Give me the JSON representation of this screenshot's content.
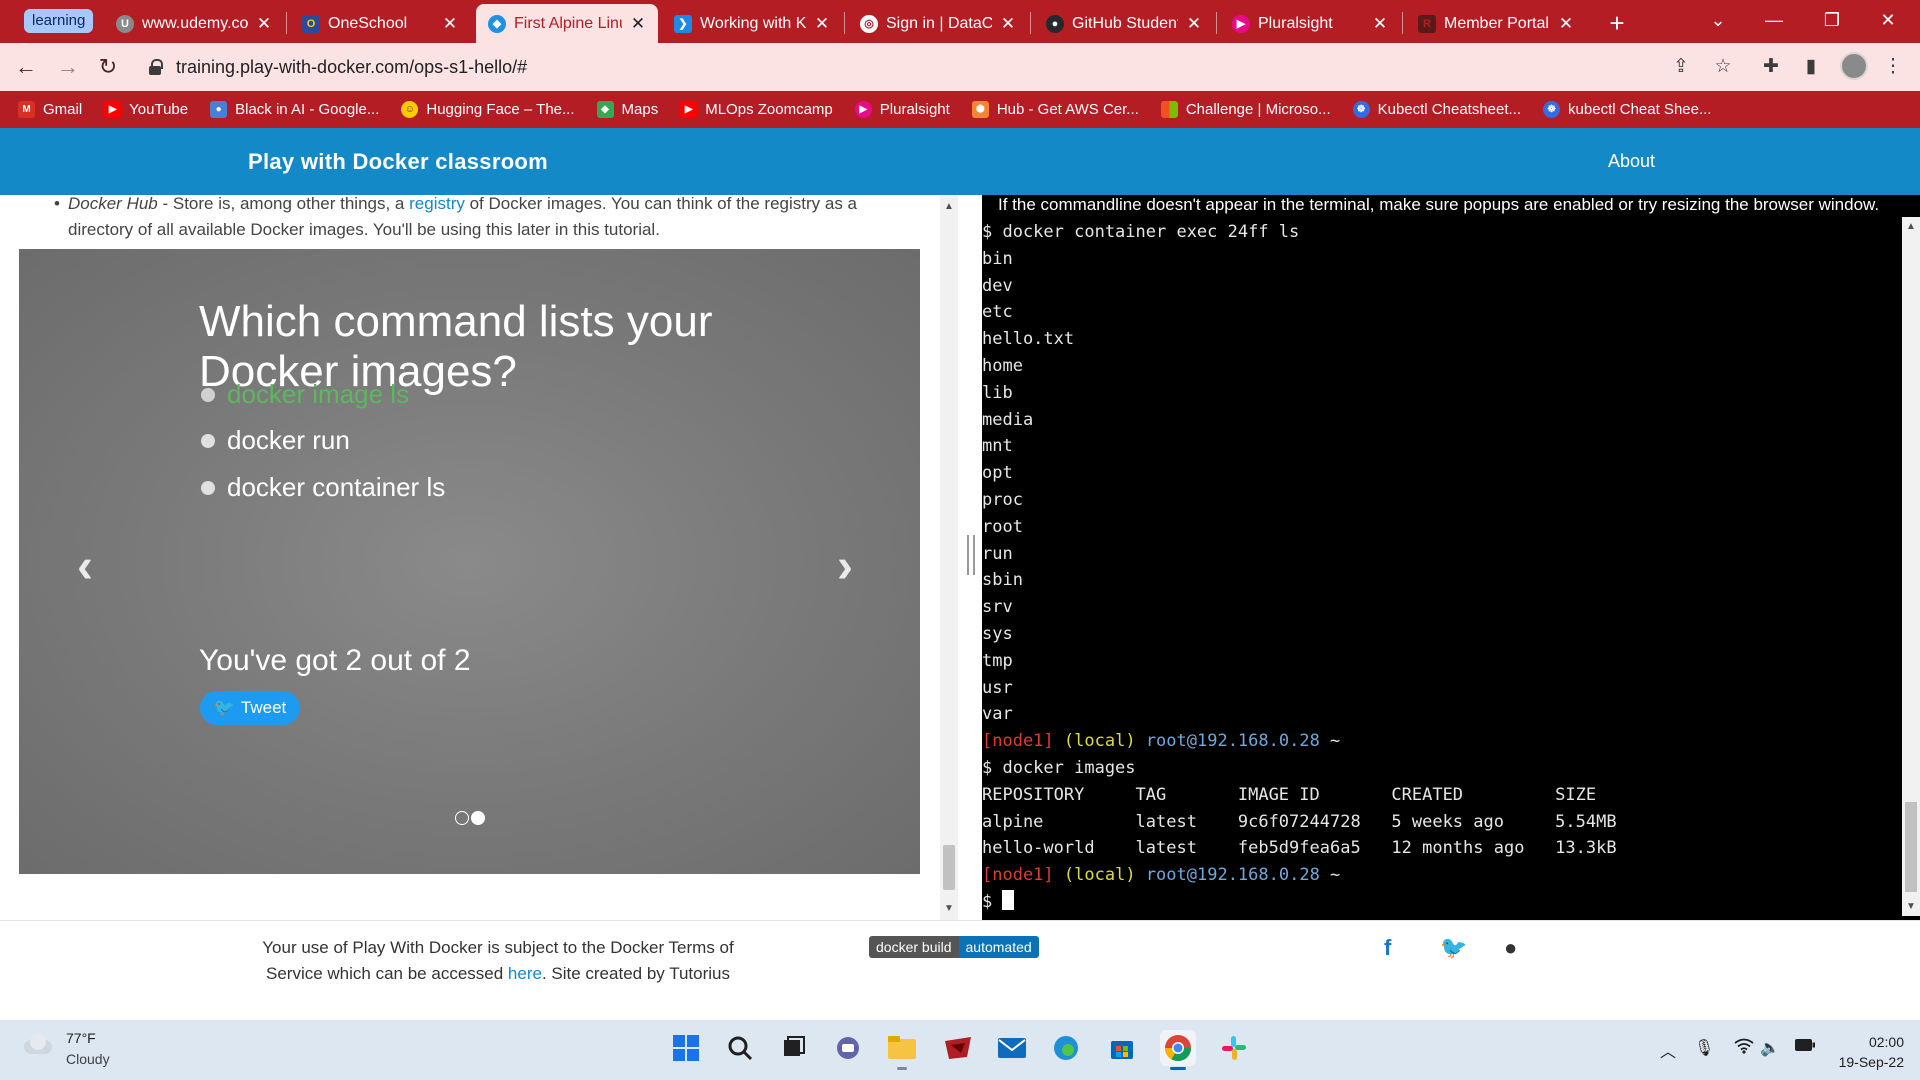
{
  "browser": {
    "tab_group_label": "learning",
    "tabs": [
      {
        "title": "www.udemy.com",
        "icon": "udemy-icon"
      },
      {
        "title": "OneSchool",
        "icon": "oneschool-icon"
      },
      {
        "title": "First Alpine Linux",
        "icon": "docker-icon",
        "active": true
      },
      {
        "title": "Working with Ku",
        "icon": "vscode-icon"
      },
      {
        "title": "Sign in | DataCa",
        "icon": "globe-icon"
      },
      {
        "title": "GitHub Student",
        "icon": "github-icon"
      },
      {
        "title": "Pluralsight",
        "icon": "pluralsight-icon"
      },
      {
        "title": "Member Portal",
        "icon": "member-portal-icon"
      }
    ],
    "url": "training.play-with-docker.com/ops-s1-hello/#",
    "bookmarks": [
      {
        "label": "Gmail",
        "color": "#d93025"
      },
      {
        "label": "YouTube",
        "color": "#ff0000"
      },
      {
        "label": "Black in AI - Google...",
        "color": "#4a7fd8"
      },
      {
        "label": "Hugging Face – The...",
        "color": "#ffcc00"
      },
      {
        "label": "Maps",
        "color": "#34a853"
      },
      {
        "label": "MLOps Zoomcamp",
        "color": "#ff0000"
      },
      {
        "label": "Pluralsight",
        "color": "#e80a89"
      },
      {
        "label": "Hub - Get AWS Cer...",
        "color": "#f58536"
      },
      {
        "label": "Challenge | Microso...",
        "color": "#7fba00"
      },
      {
        "label": "Kubectl Cheatsheet...",
        "color": "#326ce5"
      },
      {
        "label": "kubectl Cheat Shee...",
        "color": "#326ce5"
      }
    ]
  },
  "site": {
    "brand": "Play with Docker classroom",
    "nav_about": "About"
  },
  "content": {
    "intro_term": "Docker Hub",
    "intro_before_link": " - Store is, among other things, a ",
    "intro_link": "registry",
    "intro_after_link": " of Docker images. You can think of the registry as a directory of all available Docker images. You'll be using this later in this tutorial."
  },
  "quiz": {
    "question": "Which command lists your Docker images?",
    "options": [
      {
        "label": "docker image ls",
        "correct": true
      },
      {
        "label": "docker run",
        "correct": false
      },
      {
        "label": "docker container ls",
        "correct": false
      }
    ],
    "score": "You've got 2 out of 2",
    "tweet_label": "Tweet"
  },
  "terminal": {
    "note": "If the commandline doesn't appear in the terminal, make sure popups are enabled or try resizing the browser window.",
    "exec_cmd": "$ docker container exec 24ff ls",
    "ls_output": [
      "bin",
      "dev",
      "etc",
      "hello.txt",
      "home",
      "lib",
      "media",
      "mnt",
      "opt",
      "proc",
      "root",
      "run",
      "sbin",
      "srv",
      "sys",
      "tmp",
      "usr",
      "var"
    ],
    "prompt_node": "[node1]",
    "prompt_local": "(local)",
    "prompt_host": "root@192.168.0.28",
    "prompt_tilde": "~",
    "images_cmd": "$ docker images",
    "images_header": "REPOSITORY     TAG       IMAGE ID       CREATED         SIZE",
    "images_rows": [
      "alpine         latest    9c6f07244728   5 weeks ago     5.54MB",
      "hello-world    latest    feb5d9fea6a5   12 months ago   13.3kB"
    ],
    "final_prompt": "$ "
  },
  "footer": {
    "text_before": "Your use of Play With Docker is subject to the Docker Terms of Service which can be accessed ",
    "link": "here",
    "text_after": ". Site created by Tutorius",
    "badge_left": "docker build",
    "badge_right": "automated"
  },
  "taskbar": {
    "temperature": "77°F",
    "condition": "Cloudy",
    "time": "02:00",
    "date": "19-Sep-22"
  }
}
